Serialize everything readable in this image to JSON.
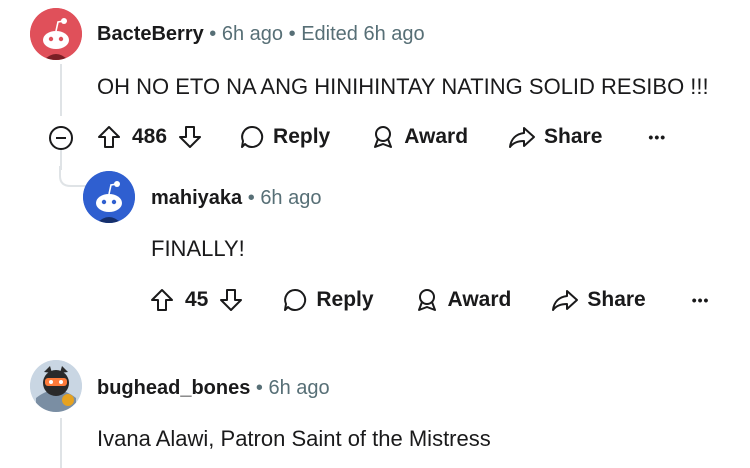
{
  "comments": [
    {
      "username": "BacteBerry",
      "separator": "•",
      "time": "6h ago",
      "edited": "Edited 6h ago",
      "text": "OH NO ETO NA ANG HINIHINTAY NATING SOLID RESIBO !!!",
      "votes": "486",
      "avatar_color": "#e0505a"
    },
    {
      "username": "mahiyaka",
      "separator": "•",
      "time": "6h ago",
      "text": "FINALLY!",
      "votes": "45",
      "avatar_color": "#2f5fd0"
    },
    {
      "username": "bughead_bones",
      "separator": "•",
      "time": "6h ago",
      "text": "Ivana Alawi, Patron Saint of the Mistress"
    }
  ],
  "actions": {
    "reply": "Reply",
    "award": "Award",
    "share": "Share",
    "more": "•••"
  },
  "icons": {
    "collapse": "minus-circle-icon",
    "upvote": "arrow-up-icon",
    "downvote": "arrow-down-icon",
    "reply": "speech-bubble-icon",
    "award": "award-ribbon-icon",
    "share": "share-arrow-icon",
    "more": "ellipsis-icon"
  }
}
